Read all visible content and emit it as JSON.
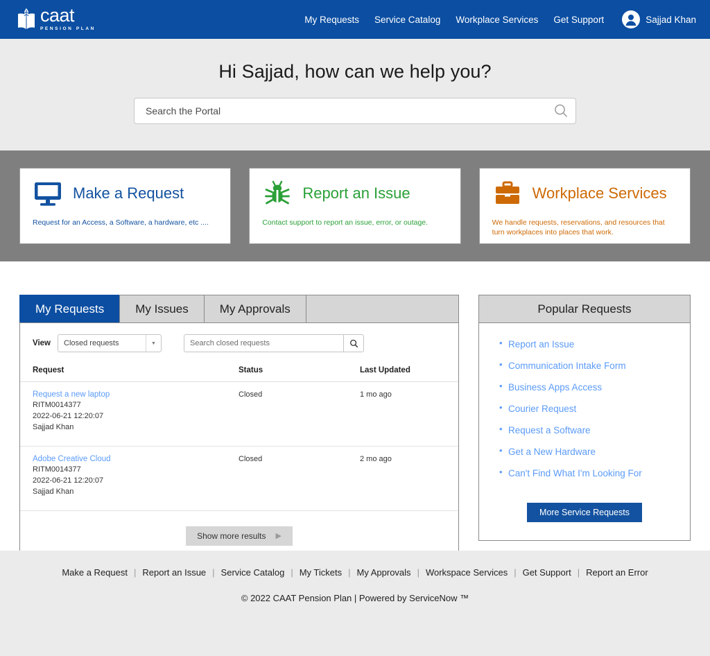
{
  "header": {
    "logo": {
      "word": "caat",
      "sub": "PENSION PLAN",
      "icon": "book-leaf-logo-icon"
    },
    "nav": [
      {
        "label": "My Requests"
      },
      {
        "label": "Service Catalog"
      },
      {
        "label": "Workplace Services"
      },
      {
        "label": "Get Support"
      }
    ],
    "user": {
      "name": "Sajjad Khan",
      "icon": "user-avatar-icon"
    },
    "bg_color": "#0b4ea2"
  },
  "hero": {
    "title": "Hi Sajjad, how can we help you?",
    "search_placeholder": "Search the Portal",
    "search_value": "",
    "search_icon": "search-icon",
    "bg_color": "#ebebeb"
  },
  "cards": {
    "band_color": "#7f7f7f",
    "items": [
      {
        "title": "Make a Request",
        "desc": "Request for an Access, a Software, a hardware, etc ....",
        "icon": "monitor-icon",
        "color": "#1352a0"
      },
      {
        "title": "Report an Issue",
        "desc": "Contact support to report an issue, error,  or outage.",
        "icon": "bug-icon",
        "color": "#2aa037"
      },
      {
        "title": "Workplace Services",
        "desc": "We handle requests, reservations, and resources that turn workplaces into places that work.",
        "icon": "briefcase-icon",
        "color": "#cd6a06"
      }
    ]
  },
  "tabs": [
    {
      "label": "My Requests",
      "active": true
    },
    {
      "label": "My Issues",
      "active": false
    },
    {
      "label": "My Approvals",
      "active": false
    }
  ],
  "requests_panel": {
    "view_label": "View",
    "view_selected": "Closed requests",
    "search_placeholder": "Search closed requests",
    "search_value": "",
    "search_icon": "search-icon",
    "columns": [
      "Request",
      "Status",
      "Last Updated"
    ],
    "rows": [
      {
        "title": "Request a new laptop",
        "number": "RITM0014377",
        "date": "2022-06-21 12:20:07",
        "requester": "Sajjad Khan",
        "status": "Closed",
        "updated": "1 mo ago"
      },
      {
        "title": "Adobe Creative Cloud",
        "number": "RITM0014377",
        "date": "2022-06-21 12:20:07",
        "requester": "Sajjad Khan",
        "status": "Closed",
        "updated": "2 mo ago"
      }
    ],
    "show_more_label": "Show more results",
    "show_more_caret": "▶"
  },
  "popular_requests": {
    "title": "Popular Requests",
    "items": [
      {
        "label": "Report an Issue"
      },
      {
        "label": "Communication Intake Form"
      },
      {
        "label": "Business Apps Access"
      },
      {
        "label": "Courier Request"
      },
      {
        "label": "Request a Software"
      },
      {
        "label": "Get a New Hardware"
      },
      {
        "label": "Can't Find What I'm Looking For"
      }
    ],
    "button_label": "More Service Requests",
    "button_color": "#1352a0"
  },
  "footer": {
    "links": [
      {
        "label": "Make a Request"
      },
      {
        "label": "Report an Issue"
      },
      {
        "label": "Service Catalog"
      },
      {
        "label": "My Tickets"
      },
      {
        "label": "My Approvals"
      },
      {
        "label": "Workspace Services"
      },
      {
        "label": "Get Support"
      },
      {
        "label": "Report an Error"
      }
    ],
    "separator": "|",
    "copyright": "© 2022 CAAT Pension Plan | Powered by ServiceNow ™"
  }
}
